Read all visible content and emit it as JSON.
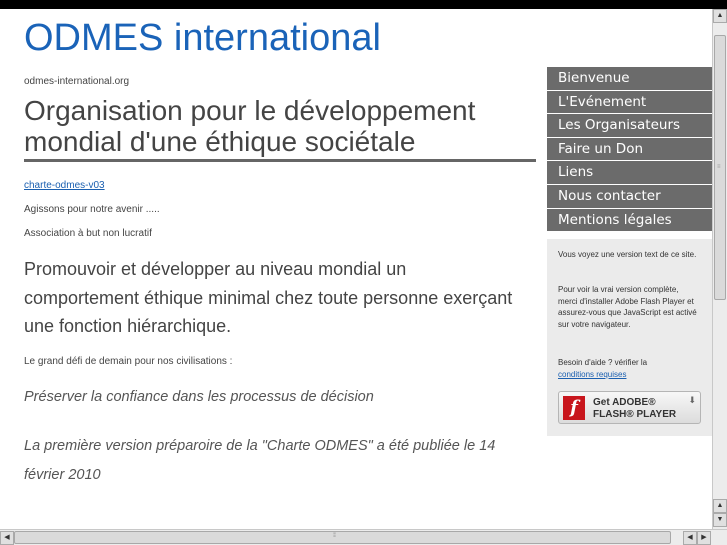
{
  "site_title": "ODMES international",
  "domain": "odmes-international.org",
  "main_heading": "Organisation pour le développement mondial d'une éthique sociétale",
  "charte_link": "charte-odmes-v03",
  "motto": "Agissons pour notre avenir .....",
  "association": "Association à but non lucratif",
  "mission": "Promouvoir et développer au niveau mondial un comportement éthique minimal chez toute personne exerçant une fonction hiérarchique.",
  "challenge": "Le grand défi de demain pour nos civilisations :",
  "preserve": "Préserver la confiance dans les processus de décision",
  "news": "La première version préparoire de la \"Charte ODMES\" a été publiée le 14 février 2010",
  "nav": {
    "items": [
      "Bienvenue",
      "L'Evénement",
      "Les Organisateurs",
      "Faire un Don",
      "Liens",
      "Nous contacter",
      "Mentions légales"
    ]
  },
  "flash_box": {
    "p1": "Vous voyez une version text de ce site.",
    "p2": "Pour voir la vrai version complète, merci d'installer Adobe Flash Player et assurez-vous que JavaScript est activé sur votre navigateur.",
    "p3_prefix": "Besoin d'aide ? vérifier la",
    "p3_link": "conditions requises",
    "button_line1": "Get ADOBE®",
    "button_line2": "FLASH® PLAYER",
    "logo_letter": "f"
  },
  "colors": {
    "title": "#1a63b8",
    "nav_bg": "#6b6b6b",
    "link": "#1a5fb0"
  }
}
